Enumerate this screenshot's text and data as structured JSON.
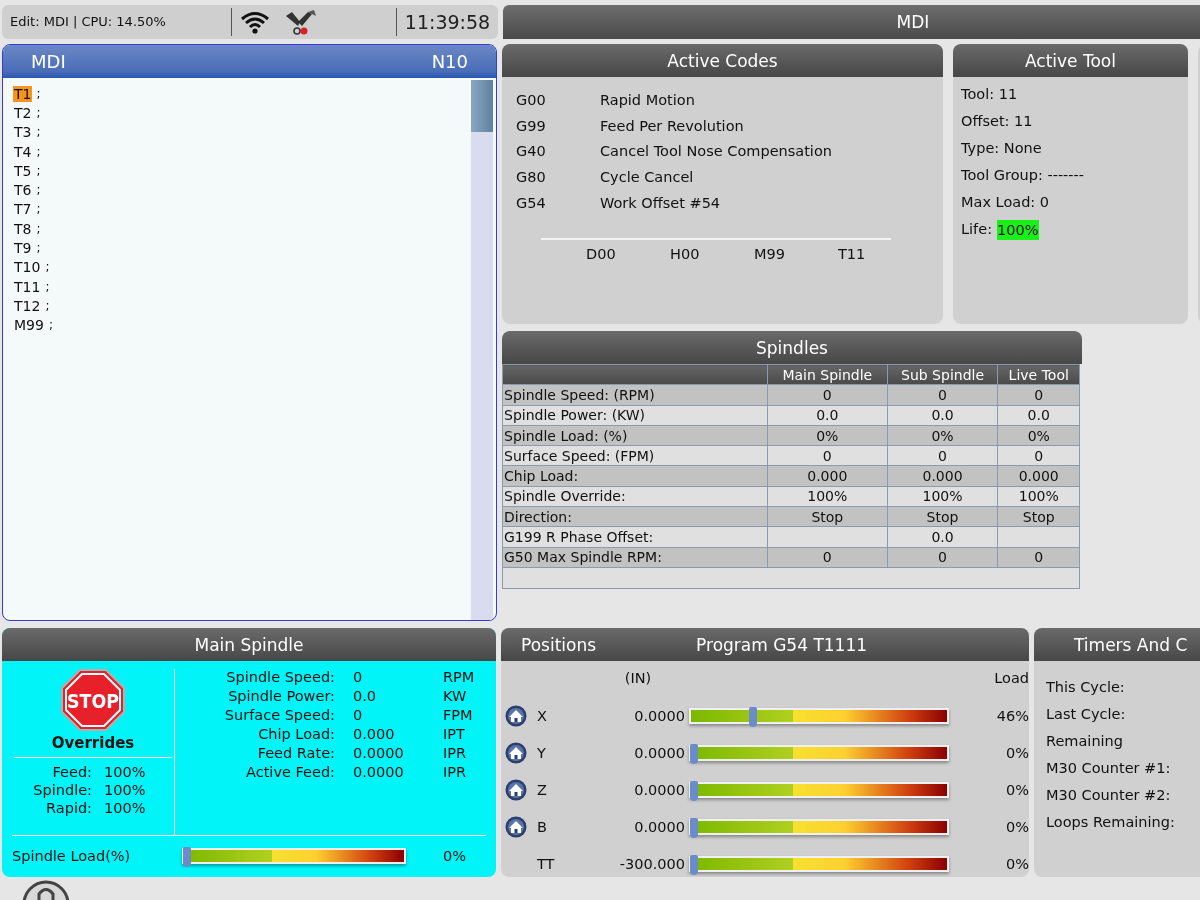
{
  "status_bar": {
    "mode": "Edit: MDI | CPU: 14.50%",
    "clock": "11:39:58"
  },
  "header": {
    "title": "MDI"
  },
  "editor": {
    "title": "MDI",
    "block": "N10",
    "lines": [
      {
        "code": "T1",
        "end": ";",
        "selected": true
      },
      {
        "code": "T2",
        "end": ";",
        "selected": false
      },
      {
        "code": "T3",
        "end": ";",
        "selected": false
      },
      {
        "code": "T4",
        "end": ";",
        "selected": false
      },
      {
        "code": "T5",
        "end": ";",
        "selected": false
      },
      {
        "code": "T6",
        "end": ";",
        "selected": false
      },
      {
        "code": "T7",
        "end": ";",
        "selected": false
      },
      {
        "code": "T8",
        "end": ";",
        "selected": false
      },
      {
        "code": "T9",
        "end": ";",
        "selected": false
      },
      {
        "code": "T10",
        "end": ";",
        "selected": false
      },
      {
        "code": "T11",
        "end": ";",
        "selected": false
      },
      {
        "code": "T12",
        "end": ";",
        "selected": false
      },
      {
        "code": "M99",
        "end": ";",
        "selected": false
      }
    ]
  },
  "active_codes": {
    "title": "Active Codes",
    "codes": [
      {
        "code": "G00",
        "description": "Rapid Motion"
      },
      {
        "code": "G99",
        "description": "Feed Per Revolution"
      },
      {
        "code": "G40",
        "description": "Cancel Tool Nose Compensation"
      },
      {
        "code": "G80",
        "description": "Cycle Cancel"
      },
      {
        "code": "G54",
        "description": "Work Offset #54"
      }
    ],
    "other": [
      "D00",
      "H00",
      "M99",
      "T11"
    ]
  },
  "active_tool": {
    "title": "Active Tool",
    "fields": [
      "Tool: 11",
      "Offset: 11",
      "Type: None",
      "Tool Group: -------",
      "Max Load: 0"
    ],
    "life": {
      "label": "Life:",
      "value": "100%"
    }
  },
  "spindles": {
    "title": "Spindles",
    "columns": [
      "Main Spindle",
      "Sub Spindle",
      "Live Tool"
    ],
    "rows": [
      {
        "label": "Spindle Speed: (RPM)",
        "main_spindle": "0",
        "sub_spindle": "0",
        "live_tool": "0"
      },
      {
        "label": "Spindle Power: (KW)",
        "main_spindle": "0.0",
        "sub_spindle": "0.0",
        "live_tool": "0.0"
      },
      {
        "label": "Spindle Load: (%)",
        "main_spindle": "0%",
        "sub_spindle": "0%",
        "live_tool": "0%"
      },
      {
        "label": "Surface Speed: (FPM)",
        "main_spindle": "0",
        "sub_spindle": "0",
        "live_tool": "0"
      },
      {
        "label": "Chip Load:",
        "main_spindle": "0.000",
        "sub_spindle": "0.000",
        "live_tool": "0.000"
      },
      {
        "label": "Spindle Override:",
        "main_spindle": "100%",
        "sub_spindle": "100%",
        "live_tool": "100%"
      },
      {
        "label": "Direction:",
        "main_spindle": "Stop",
        "sub_spindle": "Stop",
        "live_tool": "Stop"
      },
      {
        "label": "G199 R Phase Offset:",
        "sub_spindle": "0.0"
      },
      {
        "label": "G50 Max Spindle RPM:",
        "main_spindle": "0",
        "sub_spindle": "0",
        "live_tool": "0"
      }
    ]
  },
  "main_spindle": {
    "title": "Main Spindle",
    "stop_label": "STOP",
    "overrides_title": "Overrides",
    "overrides": [
      {
        "label": "Feed:",
        "value": "100%"
      },
      {
        "label": "Spindle:",
        "value": "100%"
      },
      {
        "label": "Rapid:",
        "value": "100%"
      }
    ],
    "readings": [
      {
        "label": "Spindle Speed:",
        "value": "0",
        "unit": "RPM"
      },
      {
        "label": "Spindle Power:",
        "value": "0.0",
        "unit": "KW"
      },
      {
        "label": "Surface Speed:",
        "value": "0",
        "unit": "FPM"
      },
      {
        "label": "Chip Load:",
        "value": "0.000",
        "unit": "IPT"
      },
      {
        "label": "Feed Rate:",
        "value": "0.0000",
        "unit": "IPR"
      },
      {
        "label": "Active Feed:",
        "value": "0.0000",
        "unit": "IPR"
      }
    ],
    "load": {
      "label": "Spindle Load(%)",
      "level": 0,
      "reading": "0%"
    }
  },
  "positions": {
    "title": "Positions",
    "program": "Program G54 T1111",
    "unit": "(IN)",
    "load_heading": "Load",
    "axes": [
      {
        "axis": "X",
        "home": true,
        "value": "0.0000",
        "level": 0.23,
        "load": "46%"
      },
      {
        "axis": "Y",
        "home": true,
        "value": "0.0000",
        "level": 0,
        "load": "0%"
      },
      {
        "axis": "Z",
        "home": true,
        "value": "0.0000",
        "level": 0,
        "load": "0%"
      },
      {
        "axis": "B",
        "home": true,
        "value": "0.0000",
        "level": 0,
        "load": "0%"
      },
      {
        "axis": "TT",
        "home": false,
        "value": "-300.000",
        "level": 0,
        "load": "0%"
      }
    ]
  },
  "timers": {
    "title": "Timers And C",
    "labels": [
      "This Cycle:",
      "Last Cycle:",
      "Remaining",
      "M30 Counter #1:",
      "M30 Counter #2:",
      "Loops Remaining:"
    ]
  }
}
